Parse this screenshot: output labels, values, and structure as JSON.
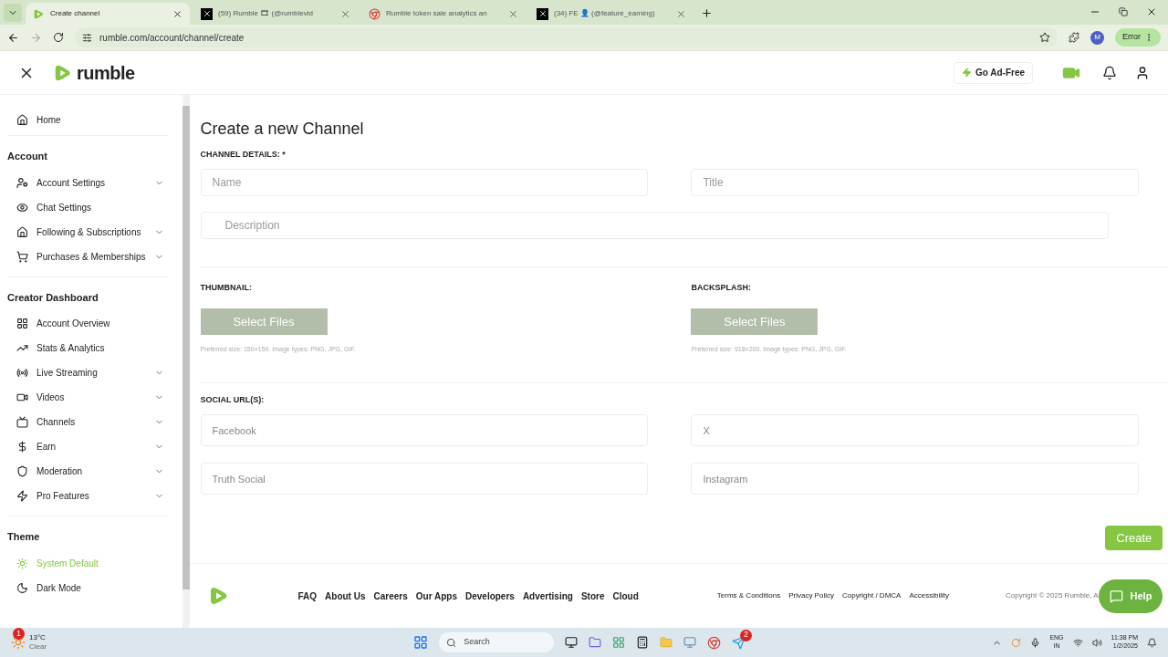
{
  "browser": {
    "tabs": [
      {
        "title": "Create channel",
        "kind": "rumble",
        "selected": true
      },
      {
        "title": "(59) Rumble 🎞 (@rumblevid",
        "kind": "x",
        "selected": false
      },
      {
        "title": "Rumble token sale analytics an",
        "kind": "chrome",
        "selected": false
      },
      {
        "title": "(34) FE 👤 (@feature_earning)",
        "kind": "x",
        "selected": false
      }
    ],
    "url": "rumble.com/account/channel/create",
    "profile": "M",
    "status": "Error"
  },
  "header": {
    "logo": "rumble",
    "ad_free": "Go Ad-Free"
  },
  "sidebar": {
    "home": "Home",
    "sections": [
      {
        "title": "Account",
        "items": [
          {
            "label": "Account Settings",
            "has_submenu": true
          },
          {
            "label": "Chat Settings",
            "has_submenu": false
          },
          {
            "label": "Following & Subscriptions",
            "has_submenu": true
          },
          {
            "label": "Purchases & Memberships",
            "has_submenu": true
          }
        ]
      },
      {
        "title": "Creator Dashboard",
        "items": [
          {
            "label": "Account Overview",
            "has_submenu": false
          },
          {
            "label": "Stats & Analytics",
            "has_submenu": false
          },
          {
            "label": "Live Streaming",
            "has_submenu": true
          },
          {
            "label": "Videos",
            "has_submenu": true
          },
          {
            "label": "Channels",
            "has_submenu": true
          },
          {
            "label": "Earn",
            "has_submenu": true
          },
          {
            "label": "Moderation",
            "has_submenu": true
          },
          {
            "label": "Pro Features",
            "has_submenu": true
          }
        ]
      }
    ],
    "theme": {
      "title": "Theme",
      "options": [
        {
          "label": "System Default",
          "selected": true
        },
        {
          "label": "Dark Mode",
          "selected": false
        }
      ]
    }
  },
  "form": {
    "title": "Create a new Channel",
    "details_label": "CHANNEL DETAILS: *",
    "name_placeholder": "Name",
    "title_placeholder": "Title",
    "description_placeholder": "Description",
    "uploads": [
      {
        "label": "THUMBNAIL:",
        "button": "Select Files",
        "hint": "Preferred size: 150×150. Image types: PNG, JPG, GIF."
      },
      {
        "label": "BACKSPLASH:",
        "button": "Select Files",
        "hint": "Preferred size: 918×200. Image types: PNG, JPG, GIF."
      }
    ],
    "social_label": "SOCIAL URL(S):",
    "social_placeholders": [
      "Facebook",
      "X",
      "Truth Social",
      "Instagram"
    ],
    "create": "Create"
  },
  "footer": {
    "links": [
      "FAQ",
      "About Us",
      "Careers",
      "Our Apps",
      "Developers",
      "Advertising",
      "Store",
      "Cloud"
    ],
    "legal": [
      "Terms & Conditions",
      "Privacy Policy",
      "Copyright / DMCA",
      "Accessibility"
    ],
    "copyright": "Copyright © 2025 Rumble, A",
    "help": "Help"
  },
  "taskbar": {
    "temperature": "13°C",
    "weather": "Clear",
    "weather_badge": "1",
    "search_placeholder": "Search",
    "telegram_badge": "2",
    "language": "ENG",
    "region": "IN",
    "time": "11:38 PM",
    "date": "1/2/2025"
  }
}
